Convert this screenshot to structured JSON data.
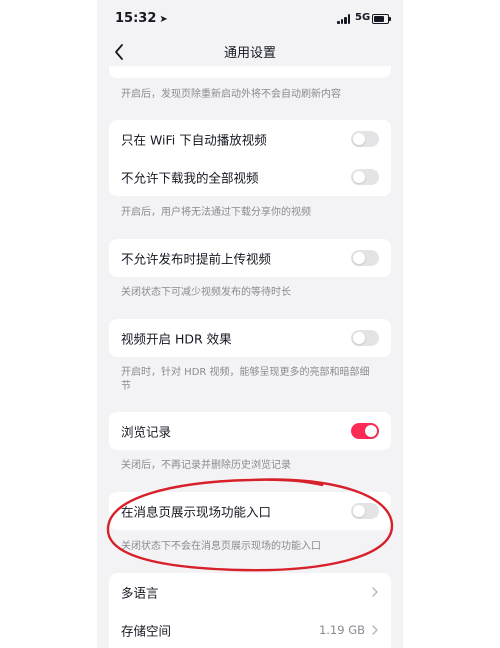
{
  "status_bar": {
    "time": "15:32",
    "network": "5G",
    "icons": [
      "location-arrow-icon",
      "signal-bars-icon",
      "battery-icon"
    ]
  },
  "nav": {
    "title": "通用设置",
    "back_icon": "chevron-left-icon"
  },
  "hints": {
    "refresh": "开启后，发现页除重新启动外将不会自动刷新内容",
    "download": "开启后，用户将无法通过下载分享你的视频",
    "upload": "关闭状态下可减少视频发布的等待时长",
    "hdr": "开启时，针对 HDR 视频，能够呈现更多的亮部和暗部细节",
    "history": "关闭后，不再记录并删除历史浏览记录",
    "message": "关闭状态下不会在消息页展示现场的功能入口"
  },
  "settings": {
    "wifi_autoplay": {
      "label": "只在 WiFi 下自动播放视频",
      "on": false
    },
    "no_download": {
      "label": "不允许下载我的全部视频",
      "on": false
    },
    "upload_early": {
      "label": "不允许发布时提前上传视频",
      "on": false
    },
    "hdr": {
      "label": "视频开启 HDR 效果",
      "on": false
    },
    "history": {
      "label": "浏览记录",
      "on": true
    },
    "message_entry": {
      "label": "在消息页展示现场功能入口",
      "on": false
    }
  },
  "menu": {
    "language": {
      "label": "多语言"
    },
    "storage": {
      "label": "存储空间",
      "value": "1.19 GB"
    }
  },
  "colors": {
    "accent": "#fe2c55",
    "toggle_off": "#e4e4e7",
    "annotation": "#d8202a",
    "background": "#f3f3f5"
  }
}
